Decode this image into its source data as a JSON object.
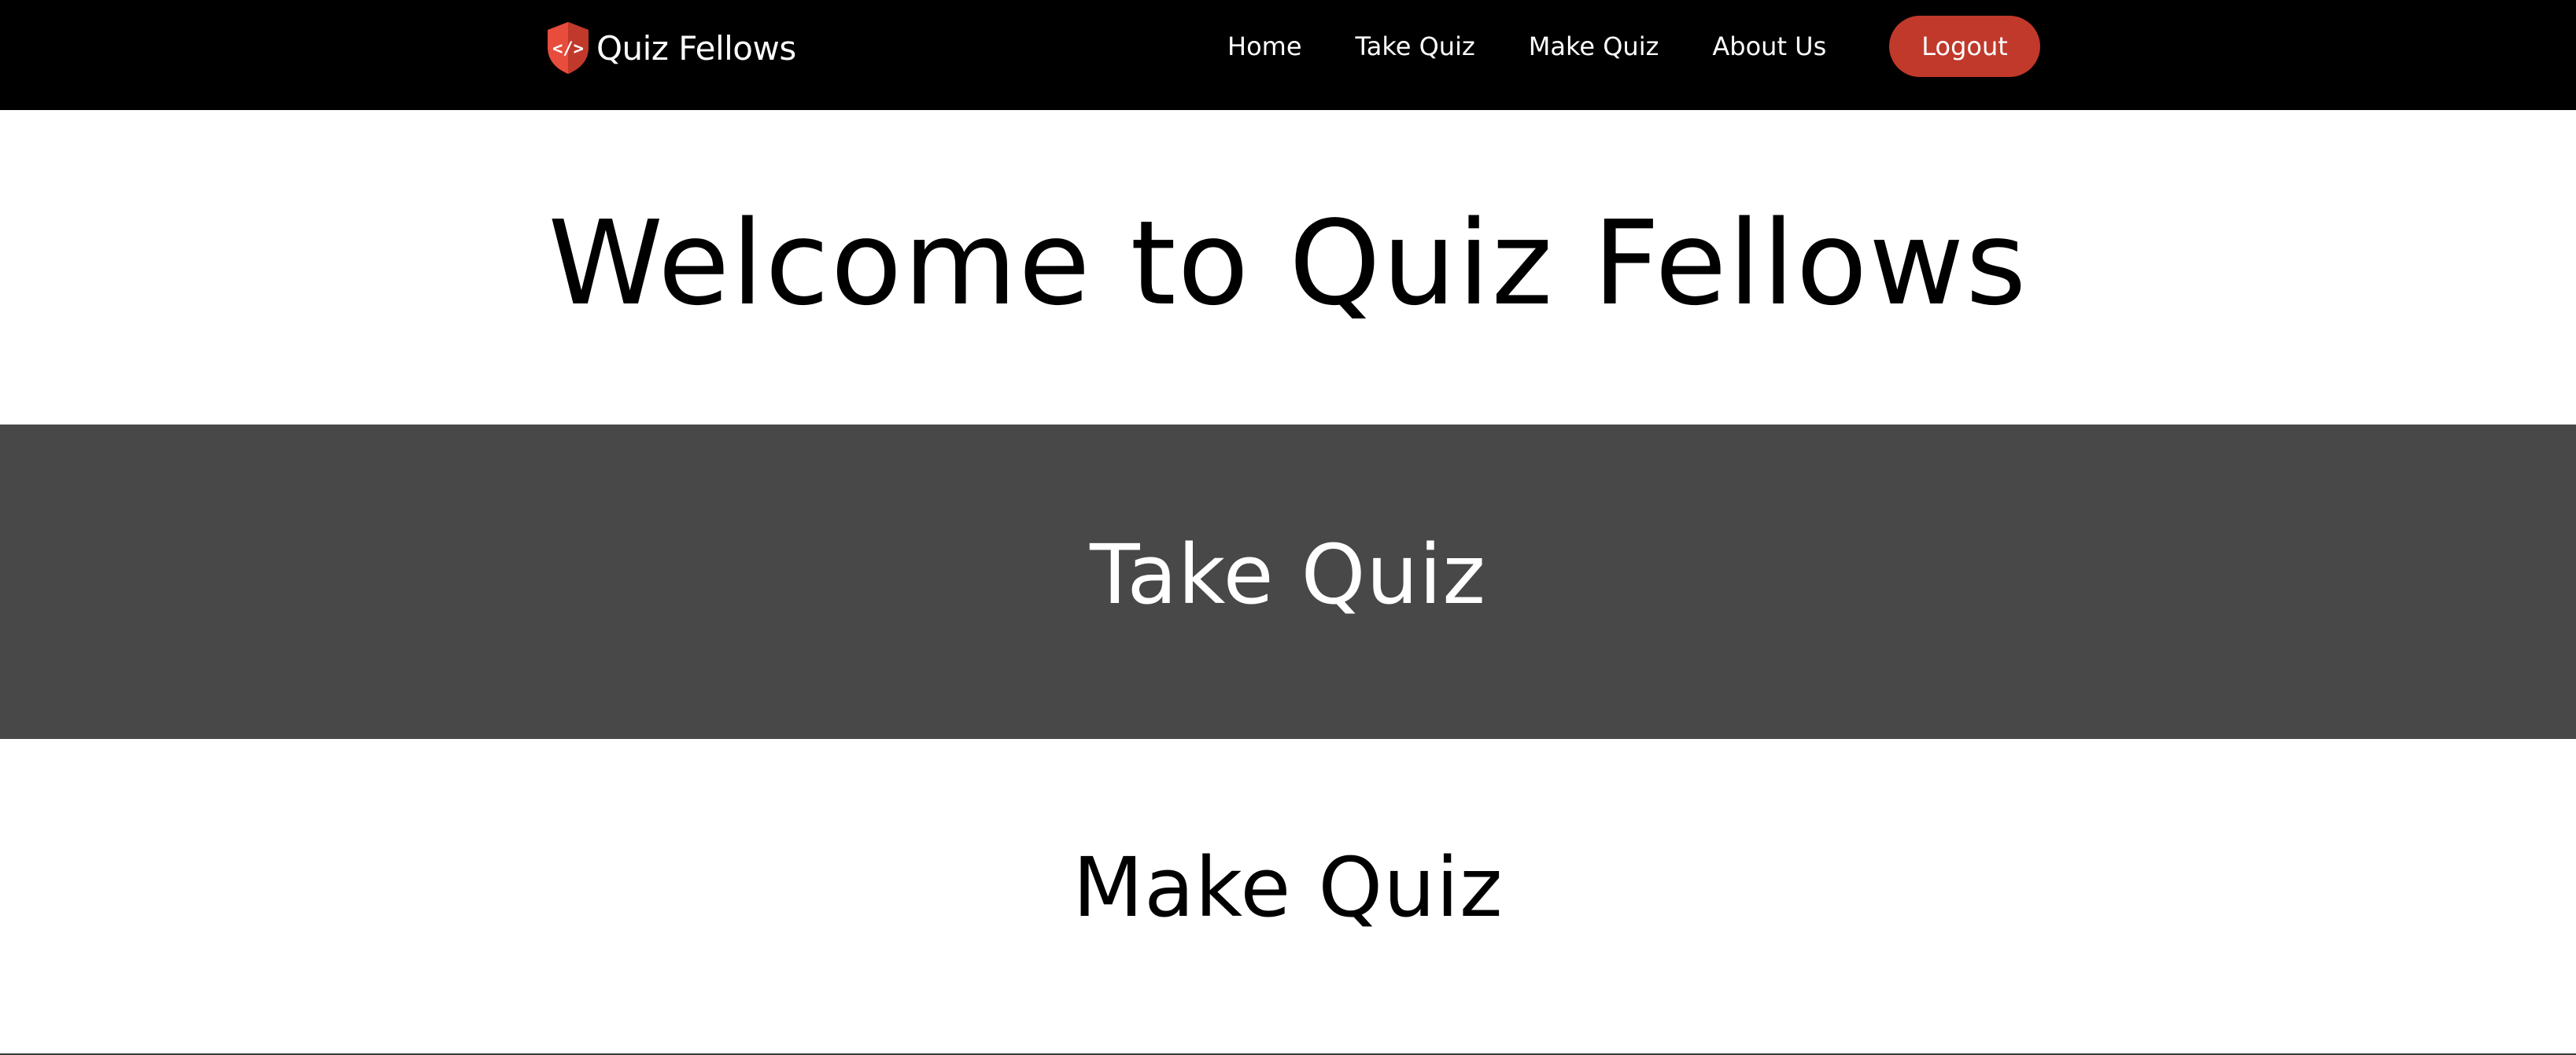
{
  "brand": {
    "name": "Quiz Fellows",
    "logo_icon": "shield-code-icon",
    "logo_glyph": "</>",
    "logo_color": "#e74c3c"
  },
  "nav": {
    "items": [
      {
        "label": "Home"
      },
      {
        "label": "Take Quiz"
      },
      {
        "label": "Make Quiz"
      },
      {
        "label": "About Us"
      }
    ],
    "logout_label": "Logout",
    "logout_color": "#c0392b"
  },
  "hero": {
    "title": "Welcome to Quiz Fellows"
  },
  "sections": {
    "take_quiz": {
      "title": "Take Quiz",
      "background": "#484848"
    },
    "make_quiz": {
      "title": "Make Quiz",
      "background": "#ffffff"
    }
  }
}
